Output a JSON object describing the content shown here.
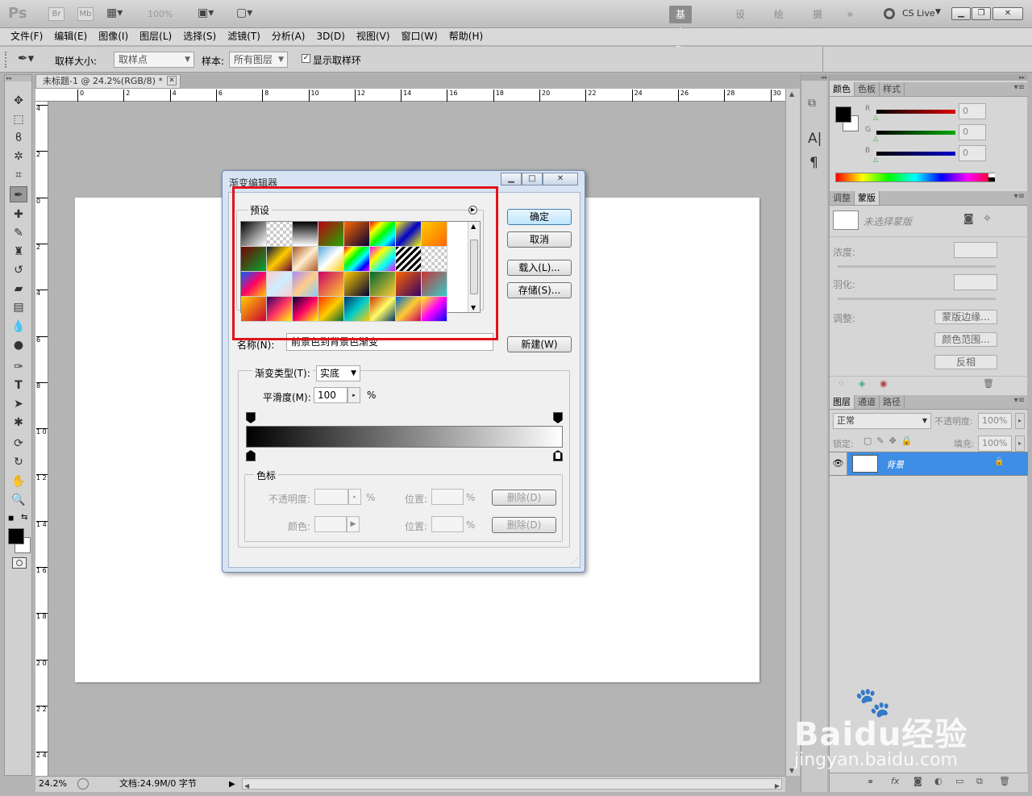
{
  "app": {
    "logo": "Ps",
    "bridge": "Br",
    "minibridge": "Mb",
    "zoom_display": "100%",
    "workspaces": [
      "基本功能",
      "设计",
      "绘画",
      "摄影"
    ],
    "more": "»",
    "cslive": "CS Live"
  },
  "menu": [
    "文件(F)",
    "编辑(E)",
    "图像(I)",
    "图层(L)",
    "选择(S)",
    "滤镜(T)",
    "分析(A)",
    "3D(D)",
    "视图(V)",
    "窗口(W)",
    "帮助(H)"
  ],
  "options": {
    "sample_size_label": "取样大小:",
    "sample_size_value": "取样点",
    "sample_label": "样本:",
    "sample_value": "所有图层",
    "show_ring_label": "显示取样环"
  },
  "document": {
    "tab_title": "未标题-1 @ 24.2%(RGB/8) *",
    "ruler_h": [
      "0",
      "2",
      "4",
      "6",
      "8",
      "10",
      "12",
      "14",
      "16",
      "18",
      "20",
      "22",
      "24",
      "26",
      "28",
      "30"
    ],
    "ruler_v": [
      "4",
      "2",
      "0",
      "2",
      "4",
      "6",
      "8",
      "1 0",
      "1 2",
      "1 4",
      "1 6",
      "1 8",
      "2 0",
      "2 2",
      "2 4"
    ],
    "zoom": "24.2%",
    "doc_info": "文档:24.9M/0 字节"
  },
  "dialog": {
    "title": "渐变编辑器",
    "presets_label": "预设",
    "ok": "确定",
    "cancel": "取消",
    "load": "载入(L)...",
    "save": "存储(S)...",
    "name_label": "名称(N):",
    "name_value": "前景色到背景色渐变",
    "new": "新建(W)",
    "type_label": "渐变类型(T):",
    "type_value": "实底",
    "smooth_label": "平滑度(M):",
    "smooth_value": "100",
    "percent": "%",
    "stops_label": "色标",
    "opacity_label": "不透明度:",
    "color_label": "颜色:",
    "position_label": "位置:",
    "delete": "删除(D)"
  },
  "panels": {
    "color_tabs": [
      "颜色",
      "色板",
      "样式"
    ],
    "rgb": [
      {
        "ch": "R",
        "val": "0"
      },
      {
        "ch": "G",
        "val": "0"
      },
      {
        "ch": "B",
        "val": "0"
      }
    ],
    "adjust_tabs": [
      "调整",
      "蒙版"
    ],
    "mask_label": "未选择蒙版",
    "density_label": "浓度:",
    "feather_label": "羽化:",
    "refine_label": "调整:",
    "mask_edge": "蒙版边缘...",
    "color_range": "颜色范围...",
    "invert": "反相",
    "layer_tabs": [
      "图层",
      "通道",
      "路径"
    ],
    "blend_mode": "正常",
    "opacity_label": "不透明度:",
    "opacity_value": "100%",
    "lock_label": "锁定:",
    "fill_label": "填充:",
    "fill_value": "100%",
    "layer_name": "背景"
  },
  "mini_dock": [
    "A|",
    "¶"
  ],
  "watermark": {
    "brand": "Baidu经验",
    "url": "jingyan.baidu.com"
  },
  "colors": {
    "highlight": "#e0141b",
    "layer_selected": "#3d8ee4",
    "dialog_frame": "#d8e4f3"
  }
}
